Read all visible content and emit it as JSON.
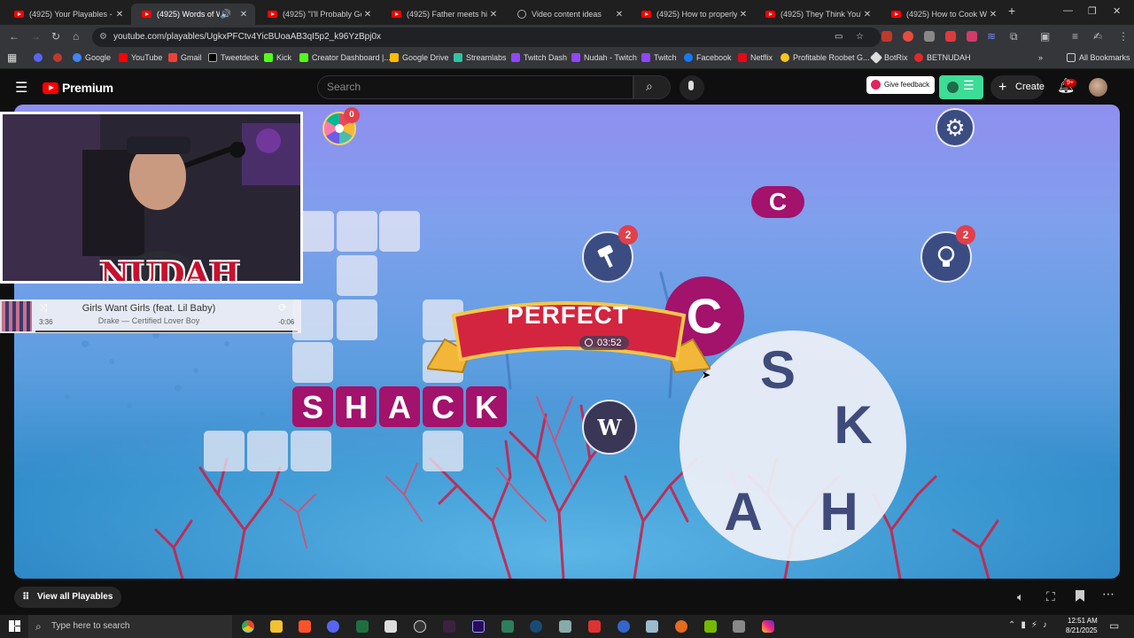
{
  "browser": {
    "tabs": [
      {
        "title": "(4925) Your Playables - Yo",
        "icon": "youtube-icon",
        "active": false
      },
      {
        "title": "(4925) Words of Wond",
        "icon": "youtube-icon",
        "active": true
      },
      {
        "title": "(4925) \"I'll Probably Get P",
        "icon": "youtube-icon",
        "active": false
      },
      {
        "title": "(4925) Father meets his ch",
        "icon": "youtube-icon",
        "active": false
      },
      {
        "title": "Video content ideas",
        "icon": "globe-icon",
        "active": false
      },
      {
        "title": "(4925) How to properly cu",
        "icon": "youtube-icon",
        "active": false
      },
      {
        "title": "(4925) They Think You're S",
        "icon": "youtube-icon",
        "active": false
      },
      {
        "title": "(4925) How to Cook With",
        "icon": "youtube-icon",
        "active": false
      }
    ],
    "url": "youtube.com/playables/UgkxPFCtv4YicBUoaAB3qI5p2_k96YzBpj0x",
    "bookmarks": [
      "Google",
      "YouTube",
      "Gmail",
      "Tweetdeck",
      "Kick",
      "Creator Dashboard |...",
      "Google Drive",
      "Streamlabs",
      "Twitch Dash",
      "Nudah - Twitch",
      "Twitch",
      "Facebook",
      "Netflix",
      "Profitable Roobet G...",
      "BotRix",
      "BETNUDAH"
    ],
    "all_bookmarks": "All Bookmarks"
  },
  "youtube": {
    "logo": "Premium",
    "search_placeholder": "Search",
    "give_feedback": "Give feedback",
    "create": "Create",
    "notifications": "9+",
    "view_all": "View all Playables"
  },
  "game": {
    "word": [
      "S",
      "H",
      "A",
      "C",
      "K"
    ],
    "banner": "PERFECT",
    "timer": "03:52",
    "wheel_letters": [
      "S",
      "K",
      "H",
      "A",
      "C"
    ],
    "preview_letter": "C",
    "hammer_count": "2",
    "hint_count": "2",
    "spin_count": "0"
  },
  "overlay": {
    "streamer_name": "NUDAH",
    "song_title": "Girls Want Girls (feat. Lil Baby)",
    "song_artist": "Drake — Certified Lover Boy",
    "elapsed": "3:36",
    "remaining": "-0:06"
  },
  "taskbar": {
    "search_placeholder": "Type here to search",
    "time": "12:51 AM",
    "date": "8/21/2025"
  },
  "colors": {
    "accent": "#a3126b",
    "youtube_red": "#ff0000",
    "banner_red": "#d3253f",
    "green_button": "#3ddc97"
  }
}
